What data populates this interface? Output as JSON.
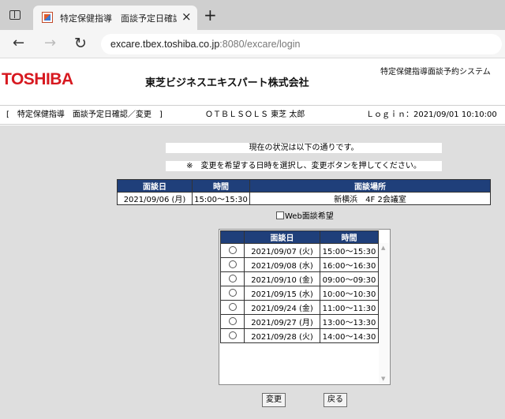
{
  "browser": {
    "tab_title": "特定保健指導　面談予定日確認...",
    "tab_close": "×",
    "new_tab": "+",
    "url_host": "excare.tbex.toshiba.co.jp",
    "url_path": ":8080/excare/login"
  },
  "header": {
    "logo": "TOSHIBA",
    "company": "東芝ビジネスエキスパート株式会社",
    "system_name": "特定保健指導面談予約システム"
  },
  "infobar": {
    "breadcrumb": "[　特定保健指導　面談予定日確認／変更　]",
    "user": "ＯＴＢＬＳＯＬＳ 東芝 太郎",
    "login": "Ｌｏｇｉｎ：2021/09/01 10:10:00"
  },
  "messages": {
    "status": "現在の状況は以下の通りです。",
    "instruction": "※　変更を希望する日時を選択し、変更ボタンを押してください。"
  },
  "current": {
    "headers": [
      "面談日",
      "時間",
      "面談場所"
    ],
    "row": [
      "2021/09/06 (月)",
      "15:00～15:30",
      "新横浜　4F 2会議室"
    ]
  },
  "web_option": "Web面談希望",
  "selection": {
    "headers": [
      "",
      "面談日",
      "時間"
    ],
    "rows": [
      {
        "date": "2021/09/07 (火)",
        "time": "15:00～15:30"
      },
      {
        "date": "2021/09/08 (水)",
        "time": "16:00～16:30"
      },
      {
        "date": "2021/09/10 (金)",
        "time": "09:00～09:30"
      },
      {
        "date": "2021/09/15 (水)",
        "time": "10:00～10:30"
      },
      {
        "date": "2021/09/24 (金)",
        "time": "11:00～11:30"
      },
      {
        "date": "2021/09/27 (月)",
        "time": "13:00～13:30"
      },
      {
        "date": "2021/09/28 (火)",
        "time": "14:00～14:30"
      }
    ]
  },
  "buttons": {
    "change": "変更",
    "back": "戻る"
  },
  "colors": {
    "brand_red": "#d71920",
    "table_header": "#1f3f7a",
    "page_gray": "#dedede"
  }
}
